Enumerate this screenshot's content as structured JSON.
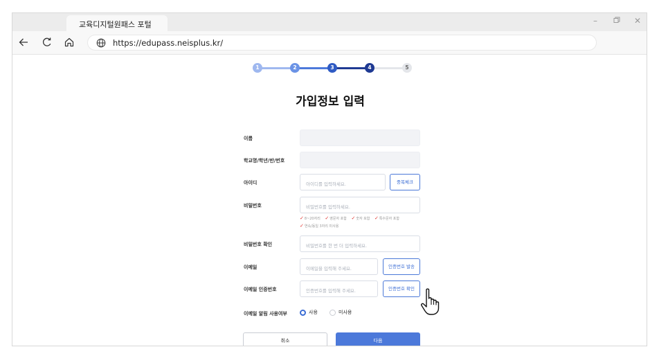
{
  "browser": {
    "tab_title": "교육디지털원패스 포털",
    "url": "https://edupass.neisplus.kr/",
    "controls": {
      "minimize": "–",
      "restore": "▢",
      "close": "✕"
    }
  },
  "stepper": {
    "steps": [
      "1",
      "2",
      "3",
      "4",
      "5"
    ],
    "current": 4,
    "colors": {
      "done_light": "#9fb8ef",
      "done": "#4c79da",
      "active": "#1f3a93",
      "pending": "#e4e6ea",
      "pending_text": "#666666"
    }
  },
  "form": {
    "title": "가입정보 입력",
    "name_label": "이름",
    "school_label": "학교명/학년/반/번호",
    "id_label": "아이디",
    "id_placeholder": "아이디를 입력하세요.",
    "id_check_button": "중복체크",
    "password_label": "비밀번호",
    "password_placeholder": "비밀번호를 입력하세요.",
    "password_rules": [
      "8~20자리",
      "영문자 포함",
      "숫자 포함",
      "특수문자 포함",
      "연속/동일 3자리 미사용"
    ],
    "password_confirm_label": "비밀번호 확인",
    "password_confirm_placeholder": "비밀번호를 한 번 더 입력하세요.",
    "email_label": "이메일",
    "email_placeholder": "이메일을 입력해 주세요.",
    "email_send_button": "인증번호 발송",
    "email_code_label": "이메일 인증번호",
    "email_code_placeholder": "인증번호를 입력해 주세요.",
    "email_code_confirm_button": "인증번호 확인",
    "email_notify_label": "이메일 알림 사용여부",
    "radio_use": "사용",
    "radio_not_use": "미사용",
    "radio_selected": "사용",
    "cancel_button": "취소",
    "next_button": "다음"
  },
  "icons": {
    "back": "arrow-left-icon",
    "refresh": "refresh-icon",
    "home": "home-icon",
    "site": "globe-icon",
    "rule_check": "checkmark-icon",
    "pointer": "hand-pointer-icon"
  }
}
